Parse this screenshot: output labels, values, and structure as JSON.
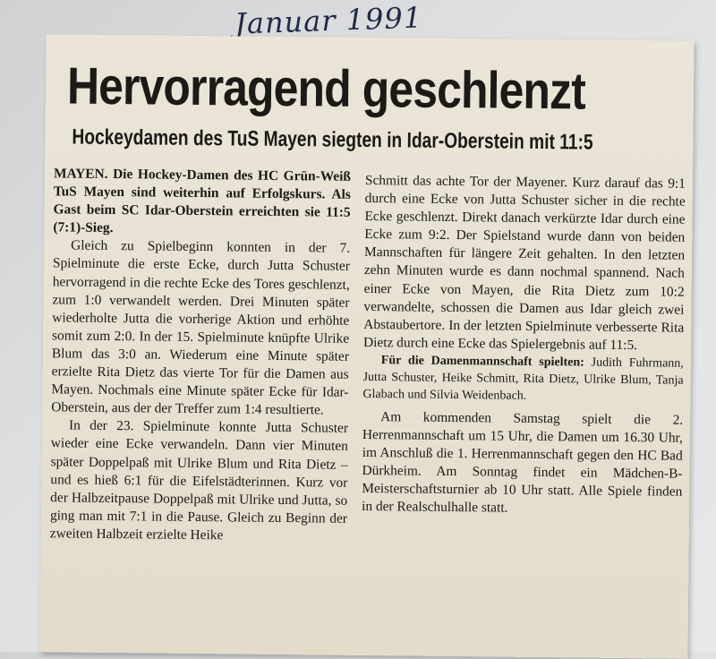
{
  "handwritten_note": "Januar 1991",
  "article": {
    "headline": "Hervorragend geschlenzt",
    "subheadline": "Hockeydamen des TuS Mayen siegten in Idar-Oberstein mit 11:5",
    "lead": "MAYEN. Die Hockey-Damen des HC Grün-Weiß TuS Mayen sind weiterhin auf Erfolgskurs. Als Gast beim SC Idar-Oberstein erreichten sie 11:5 (7:1)-Sieg.",
    "para1": "Gleich zu Spielbeginn konnten in der 7. Spielminute die erste Ecke, durch Jutta Schuster hervorragend in die rechte Ecke des Tores geschlenzt, zum 1:0 verwandelt werden. Drei Minuten später wiederholte Jutta die vorherige Aktion und erhöhte somit zum 2:0. In der 15. Spielminute knüpfte Ulrike Blum das 3:0 an. Wiederum eine Minute später erzielte Rita Dietz das vierte Tor für die Damen aus Mayen. Nochmals eine Minute später Ecke für Idar-Oberstein, aus der der Treffer zum 1:4 resultierte.",
    "para2": "In der 23. Spielminute konnte Jutta Schuster wieder eine Ecke verwandeln. Dann vier Minuten später Doppelpaß mit Ulrike Blum und Rita Dietz – und es hieß 6:1 für die Eifelstädterinnen. Kurz vor der Halbzeitpause Doppelpaß mit Ulrike und Jutta, so ging man mit 7:1 in die Pause. Gleich zu Beginn der zweiten Halbzeit erzielte Heike",
    "para3": "Schmitt das achte Tor der Mayener. Kurz darauf das 9:1 durch eine Ecke von Jutta Schuster sicher in die rechte Ecke geschlenzt. Direkt danach verkürzte Idar durch eine Ecke zum 9:2. Der Spielstand wurde dann von beiden Mannschaften für längere Zeit gehalten. In den letzten zehn Minuten wurde es dann nochmal spannend. Nach einer Ecke von Mayen, die Rita Dietz zum 10:2 verwandelte, schossen die Damen aus Idar gleich zwei Abstaubertore. In der letzten Spielminute verbesserte Rita Dietz durch eine Ecke das Spielergebnis auf 11:5.",
    "roster_label": "Für die Damenmannschaft spielten:",
    "roster_names": "Judith Fuhrmann, Jutta Schuster, Heike Schmitt, Rita Dietz, Ulrike Blum, Tanja Glabach und Silvia Weidenbach.",
    "para4": "Am kommenden Samstag spielt die 2. Herrenmannschaft um 15 Uhr, die Damen um 16.30 Uhr, im Anschluß die 1. Herrenmannschaft gegen den HC Bad Dürkheim. Am Sonntag findet ein Mädchen-B-Meisterschaftsturnier ab 10 Uhr statt. Alle Spiele finden in der Realschulhalle statt."
  }
}
